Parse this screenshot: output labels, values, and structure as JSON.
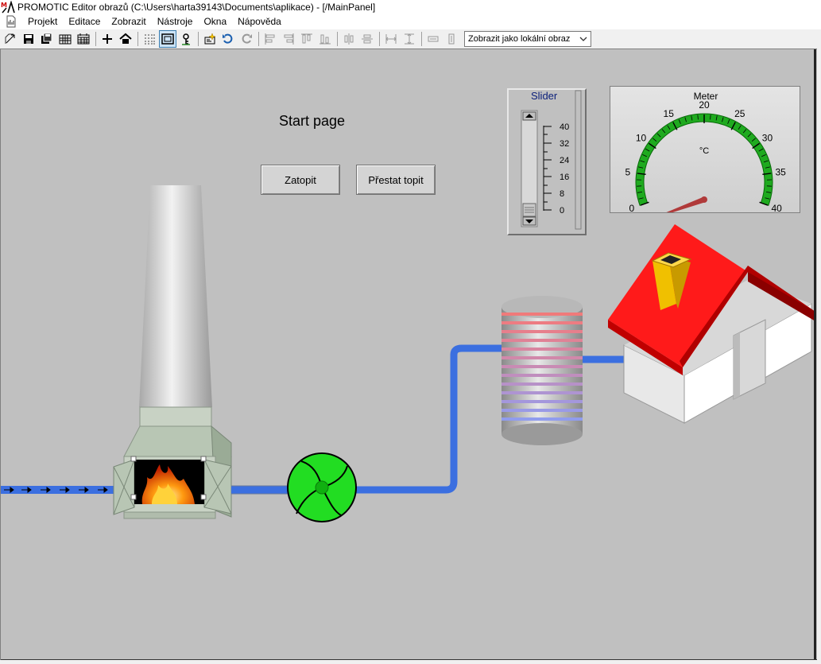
{
  "window": {
    "title": "PROMOTIC Editor obrazů (C:\\Users\\harta39143\\Documents\\aplikace)  - [/MainPanel]"
  },
  "menu": {
    "items": [
      {
        "label": "Projekt"
      },
      {
        "label": "Editace"
      },
      {
        "label": "Zobrazit"
      },
      {
        "label": "Nástroje"
      },
      {
        "label": "Okna"
      },
      {
        "label": "Nápověda"
      }
    ]
  },
  "toolbar": {
    "view_select_value": "Zobrazit jako lokální obraz",
    "icons": [
      "new-icon",
      "save-icon",
      "save-all-icon",
      "grid-icon",
      "calendar-icon",
      "add-icon",
      "home-icon",
      "dotted-grid-icon",
      "frame-icon",
      "key-icon",
      "wizard-icon",
      "undo-icon",
      "redo-icon",
      "align-left-icon",
      "align-center-icon",
      "align-top-icon",
      "align-bottom-icon",
      "distribute-h-icon",
      "distribute-v-icon",
      "same-width-icon",
      "same-height-icon",
      "resize-h-icon",
      "resize-v-icon"
    ]
  },
  "canvas": {
    "page_title": "Start page",
    "buttons": {
      "start_heating": "Zatopit",
      "stop_heating": "Přestat topit"
    },
    "slider": {
      "title": "Slider",
      "ticks": [
        "40",
        "32",
        "24",
        "16",
        "8",
        "0"
      ],
      "value": 0
    },
    "meter": {
      "title": "Meter",
      "unit": "°C",
      "ticks": [
        "0",
        "5",
        "10",
        "15",
        "20",
        "25",
        "30",
        "35",
        "40"
      ],
      "min": 0,
      "max": 40,
      "value": 0
    }
  },
  "colors": {
    "pipe": "#3b6fe0",
    "fan": "#22dd22",
    "roof": "#ff1a1a",
    "meter_arc": "#1faa1f",
    "needle": "#b03a3a"
  }
}
